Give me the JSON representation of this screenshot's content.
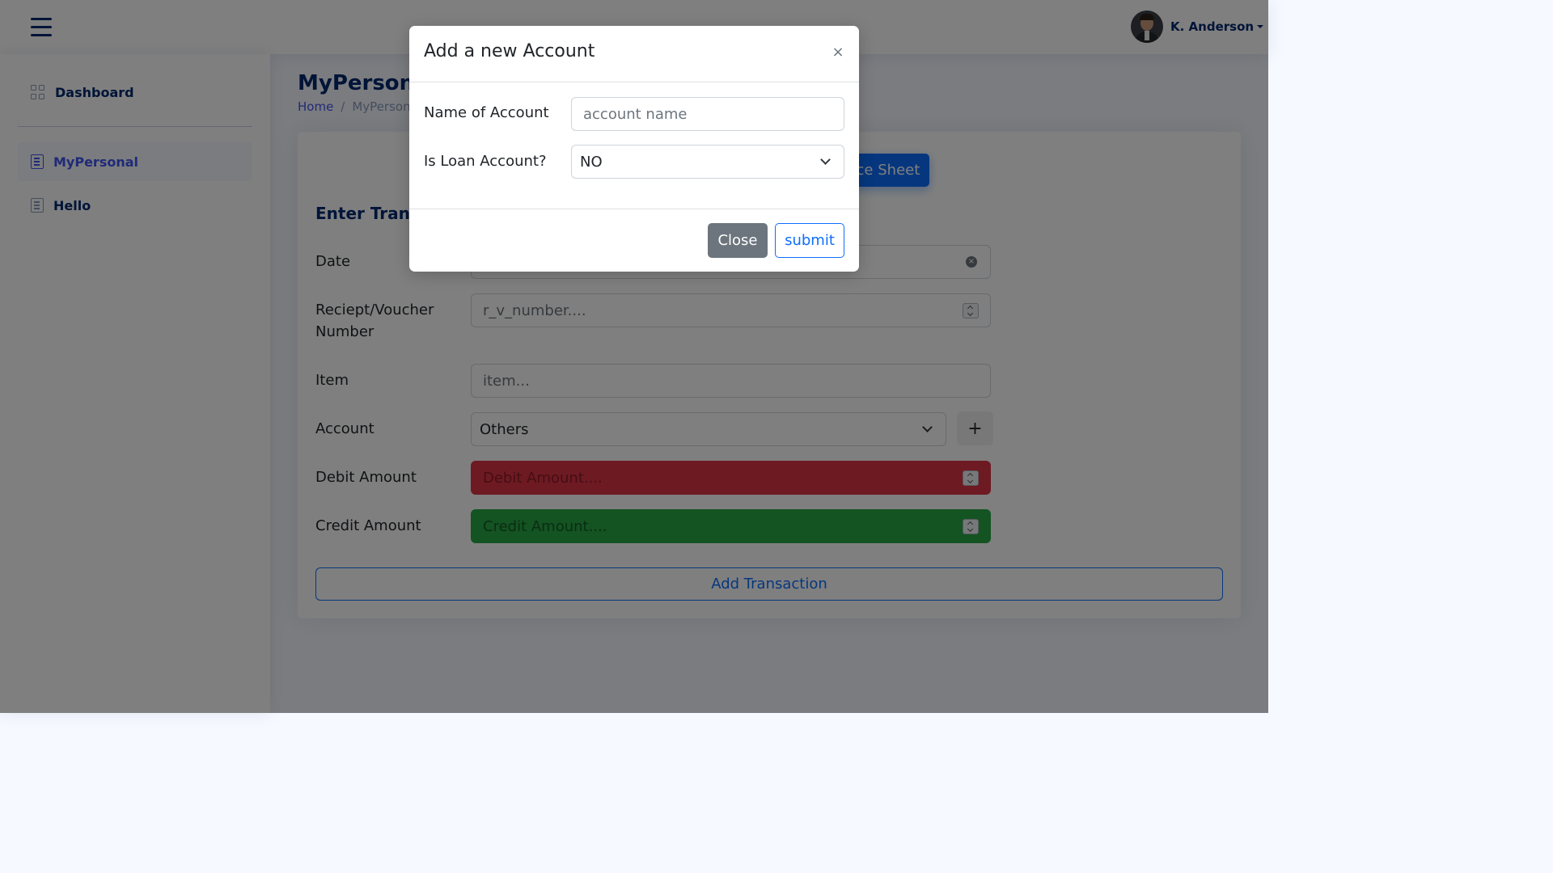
{
  "header": {
    "user_name": "K. Anderson"
  },
  "sidebar": {
    "items": [
      {
        "label": "Dashboard",
        "icon": "grid-icon"
      },
      {
        "label": "MyPersonal",
        "icon": "journal-icon",
        "active": true
      },
      {
        "label": "Hello",
        "icon": "journal-icon"
      }
    ]
  },
  "main": {
    "page_title": "MyPersonal",
    "breadcrumb": [
      "Home",
      "/",
      "MyPersonal"
    ],
    "balance_button": "Balance Sheet",
    "section_title": "Enter Transaction",
    "form": {
      "date_label": "Date",
      "voucher_label": "Reciept/Voucher Number",
      "voucher_placeholder": "r_v_number....",
      "item_label": "Item",
      "item_placeholder": "item...",
      "account_label": "Account",
      "account_value": "Others",
      "add_account_button": "+",
      "debit_label": "Debit Amount",
      "debit_placeholder": "Debit Amount....",
      "credit_label": "Credit Amount",
      "credit_placeholder": "Credit Amount...."
    },
    "add_transaction_button": "Add Transaction"
  },
  "modal": {
    "title": "Add a new Account",
    "close_icon": "×",
    "name_label": "Name of Account",
    "name_placeholder": "account name",
    "loan_label": "Is Loan Account?",
    "loan_value": "NO",
    "close_button": "Close",
    "submit_button": "submit"
  },
  "colors": {
    "primary": "#0d6efd",
    "brand_navy": "#012970",
    "debit_bg": "#dc3545",
    "credit_bg": "#28a745",
    "secondary_btn": "#6c757d"
  }
}
